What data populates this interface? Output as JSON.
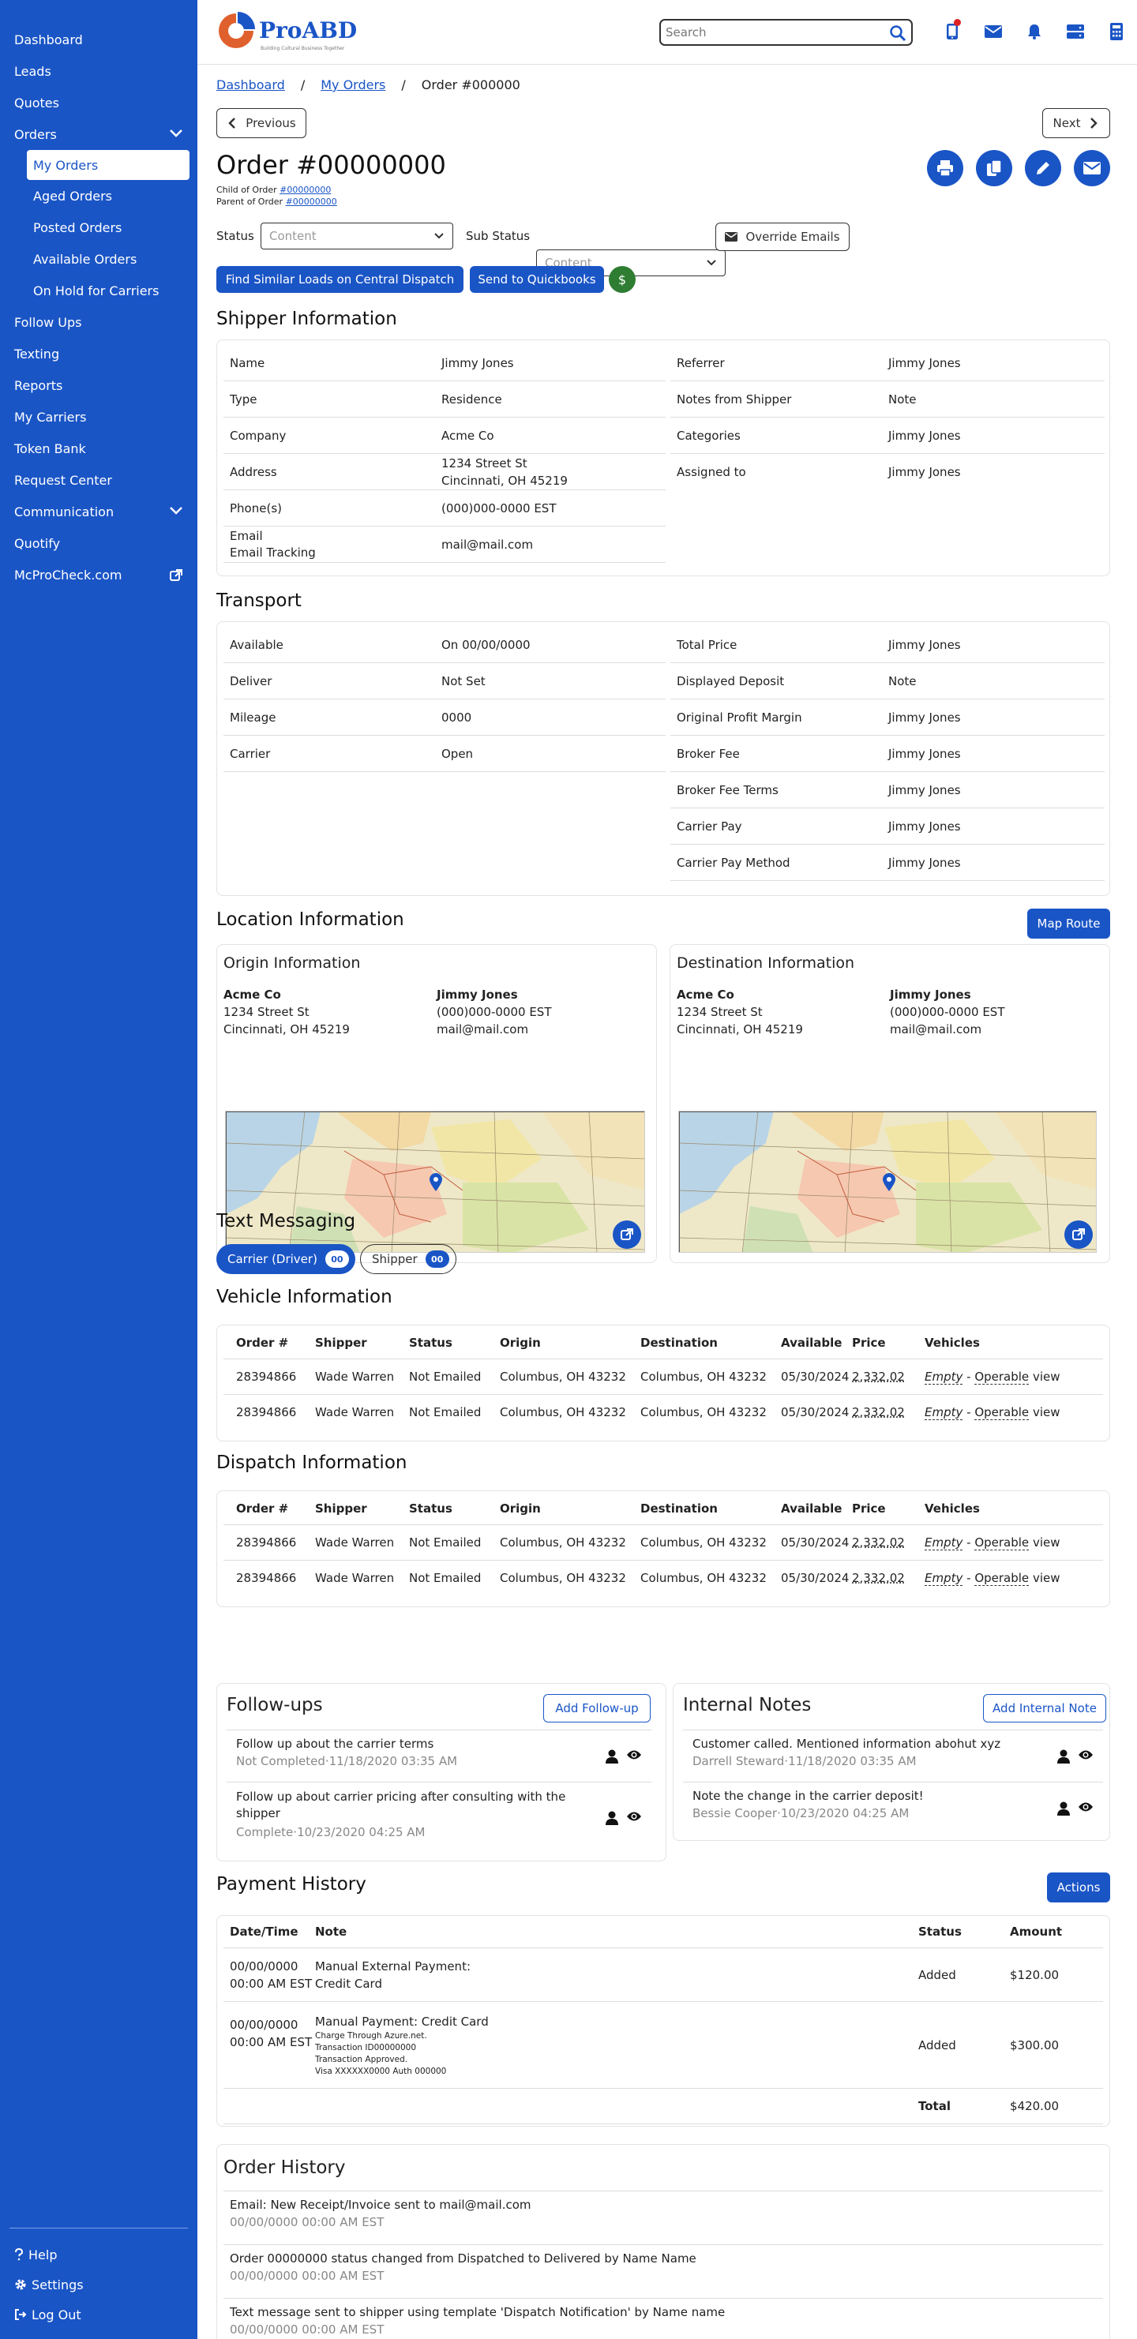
{
  "sidebar": {
    "items": [
      {
        "label": "Dashboard"
      },
      {
        "label": "Leads"
      },
      {
        "label": "Quotes"
      },
      {
        "label": "Orders"
      },
      {
        "label": "My Orders"
      },
      {
        "label": "Aged Orders"
      },
      {
        "label": "Posted Orders"
      },
      {
        "label": "Available Orders"
      },
      {
        "label": "On Hold for Carriers"
      },
      {
        "label": "Follow Ups"
      },
      {
        "label": "Texting"
      },
      {
        "label": "Reports"
      },
      {
        "label": "My Carriers"
      },
      {
        "label": "Token Bank"
      },
      {
        "label": "Request Center"
      },
      {
        "label": "Communication"
      },
      {
        "label": "Quotify"
      },
      {
        "label": "McProCheck.com"
      }
    ],
    "bottom": {
      "help": "Help",
      "settings": "Settings",
      "logout": "Log Out"
    }
  },
  "header": {
    "logo": "ProABD",
    "tagline": "Building Cultural Business Together",
    "search_placeholder": "Search"
  },
  "breadcrumb": {
    "home": "Dashboard",
    "sep": "/",
    "orders": "My Orders",
    "current": "Order #000000"
  },
  "nav": {
    "previous": "Previous",
    "next": "Next"
  },
  "order": {
    "title": "Order #00000000",
    "child_label": "Child of Order ",
    "child_link": "#00000000",
    "parent_label": "Parent of Order ",
    "parent_link": "#00000000"
  },
  "status": {
    "label": "Status",
    "value": "Content",
    "sub_label": "Sub Status",
    "sub_value": "Content",
    "override": "Override Emails"
  },
  "actions": {
    "find_similar": "Find Similar Loads on Central Dispatch",
    "quickbooks": "Send to Quickbooks",
    "dollar": "$"
  },
  "shipper": {
    "title": "Shipper Information",
    "left": [
      {
        "k": "Name",
        "v": "Jimmy Jones"
      },
      {
        "k": "Type",
        "v": "Residence"
      },
      {
        "k": "Company",
        "v": "Acme Co"
      },
      {
        "k": "Address",
        "v": "1234 Street St",
        "v2": "Cincinnati, OH 45219"
      },
      {
        "k": "Phone(s)",
        "v": "(000)000-0000 EST"
      },
      {
        "k": "Email",
        "k2": "Email Tracking",
        "v": "mail@mail.com"
      }
    ],
    "right": [
      {
        "k": "Referrer",
        "v": "Jimmy Jones"
      },
      {
        "k": "Notes from Shipper",
        "v": "Note"
      },
      {
        "k": "Categories",
        "v": "Jimmy Jones"
      },
      {
        "k": "Assigned to",
        "v": "Jimmy Jones"
      }
    ]
  },
  "transport": {
    "title": "Transport",
    "left": [
      {
        "k": "Available",
        "v": "On 00/00/0000"
      },
      {
        "k": "Deliver",
        "v": "Not Set"
      },
      {
        "k": "Mileage",
        "v": "0000"
      },
      {
        "k": "Carrier",
        "v": "Open"
      }
    ],
    "right": [
      {
        "k": "Total Price",
        "v": "Jimmy Jones"
      },
      {
        "k": "Displayed Deposit",
        "v": "Note"
      },
      {
        "k": "Original Profit Margin",
        "v": "Jimmy Jones"
      },
      {
        "k": "Broker Fee",
        "v": "Jimmy Jones"
      },
      {
        "k": "Broker Fee Terms",
        "v": "Jimmy Jones"
      },
      {
        "k": "Carrier Pay",
        "v": "Jimmy Jones"
      },
      {
        "k": "Carrier Pay Method",
        "v": "Jimmy Jones"
      }
    ]
  },
  "location": {
    "title": "Location Information",
    "map_route": "Map Route",
    "origin": {
      "title": "Origin Information",
      "company": "Acme Co",
      "street": "1234 Street St",
      "city": "Cincinnati, OH 45219",
      "contact": "Jimmy Jones",
      "phone": "(000)000-0000 EST",
      "email": "mail@mail.com"
    },
    "destination": {
      "title": "Destination Information",
      "company": "Acme Co",
      "street": "1234 Street St",
      "city": "Cincinnati, OH 45219",
      "contact": "Jimmy Jones",
      "phone": "(000)000-0000 EST",
      "email": "mail@mail.com"
    }
  },
  "texting": {
    "title": "Text Messaging",
    "carrier": "Carrier (Driver)",
    "carrier_count": "00",
    "shipper": "Shipper",
    "shipper_count": "00"
  },
  "vehicle": {
    "title": "Vehicle Information",
    "headers": [
      "Order #",
      "Shipper",
      "Status",
      "Origin",
      "Destination",
      "Available",
      "Price",
      "Vehicles"
    ],
    "rows": [
      {
        "order": "28394866",
        "shipper": "Wade Warren",
        "status": "Not Emailed",
        "origin": "Columbus, OH 43232",
        "dest": "Columbus, OH 43232",
        "available": "05/30/2024",
        "price": "2,332.02",
        "v1": "Empty",
        "dash": " - ",
        "v2": "Operable",
        "view": " view"
      },
      {
        "order": "28394866",
        "shipper": "Wade Warren",
        "status": "Not Emailed",
        "origin": "Columbus, OH 43232",
        "dest": "Columbus, OH 43232",
        "available": "05/30/2024",
        "price": "2,332.02",
        "v1": "Empty",
        "dash": " - ",
        "v2": "Operable",
        "view": " view"
      }
    ]
  },
  "dispatch": {
    "title": "Dispatch Information",
    "headers": [
      "Order #",
      "Shipper",
      "Status",
      "Origin",
      "Destination",
      "Available",
      "Price",
      "Vehicles"
    ],
    "rows": [
      {
        "order": "28394866",
        "shipper": "Wade Warren",
        "status": "Not Emailed",
        "origin": "Columbus, OH 43232",
        "dest": "Columbus, OH 43232",
        "available": "05/30/2024",
        "price": "2,332.02",
        "v1": "Empty",
        "dash": " - ",
        "v2": "Operable",
        "view": " view"
      },
      {
        "order": "28394866",
        "shipper": "Wade Warren",
        "status": "Not Emailed",
        "origin": "Columbus, OH 43232",
        "dest": "Columbus, OH 43232",
        "available": "05/30/2024",
        "price": "2,332.02",
        "v1": "Empty",
        "dash": " - ",
        "v2": "Operable",
        "view": " view"
      }
    ]
  },
  "followups": {
    "title": "Follow-ups",
    "add": "Add Follow-up",
    "items": [
      {
        "text": "Follow up about the carrier terms",
        "status": "Not Completed",
        "sep": "·",
        "date": "11/18/2020 03:35 AM"
      },
      {
        "text": "Follow up about carrier pricing after consulting with the shipper",
        "status": "Complete",
        "sep": "·",
        "date": "10/23/2020 04:25 AM"
      }
    ]
  },
  "internal": {
    "title": "Internal Notes",
    "add": "Add Internal Note",
    "items": [
      {
        "text": "Customer called. Mentioned information abohut xyz",
        "author": "Darrell Steward",
        "sep": "·",
        "date": "11/18/2020 03:35 AM"
      },
      {
        "text": "Note the change in the carrier deposit!",
        "author": "Bessie Cooper",
        "sep": "·",
        "date": "10/23/2020 04:25 AM"
      }
    ]
  },
  "payment": {
    "title": "Payment History",
    "actions": "Actions",
    "headers": {
      "date": "Date/Time",
      "note": "Note",
      "status": "Status",
      "amount": "Amount"
    },
    "rows": [
      {
        "date1": "00/00/0000",
        "date2": "00:00 AM EST",
        "note1": "Manual External Payment:",
        "note2": "Credit Card",
        "status": "Added",
        "amount": "$120.00"
      },
      {
        "date1": "00/00/0000",
        "date2": "00:00 AM EST",
        "note1": "Manual Payment: Credit Card",
        "small1": "Charge Through Azure.net.",
        "small2": "Transaction ID00000000",
        "small3": "Transaction Approved.",
        "small4": "Visa XXXXXX0000 Auth 000000",
        "status": "Added",
        "amount": "$300.00"
      }
    ],
    "total_label": "Total",
    "total": "$420.00"
  },
  "history": {
    "title": "Order History",
    "items": [
      {
        "text": "Email: New Receipt/Invoice sent to mail@mail.com",
        "date": "00/00/0000 00:00 AM EST"
      },
      {
        "text": "Order 00000000 status changed from Dispatched to Delivered by Name Name",
        "date": "00/00/0000 00:00 AM EST"
      },
      {
        "text": "Text message sent to shipper using template 'Dispatch Notification' by Name name",
        "date": "00/00/0000 00:00 AM EST"
      }
    ]
  },
  "colors": {
    "primary": "#1a55c6",
    "green": "#2e7d32"
  }
}
